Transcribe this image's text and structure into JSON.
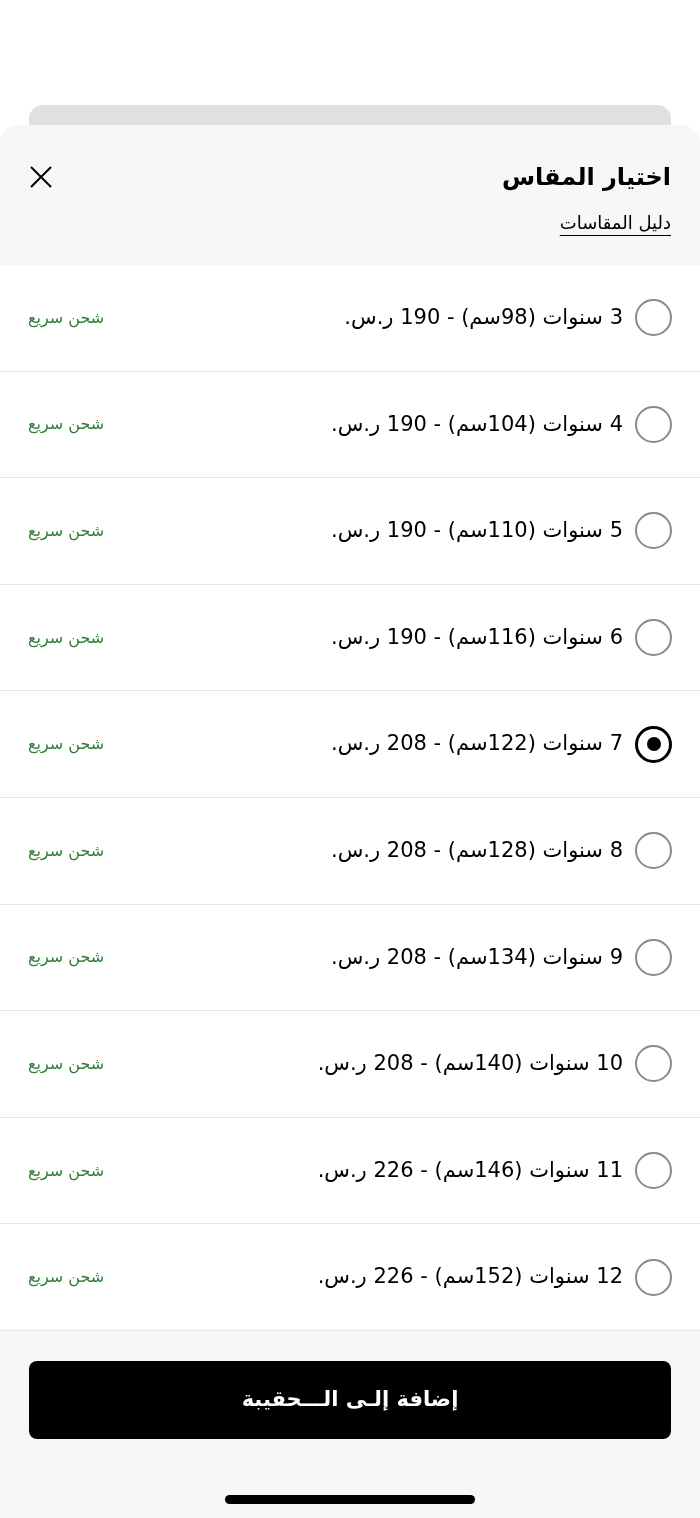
{
  "sheet": {
    "title": "اختيار المقاس",
    "size_guide_link": "دليل المقاسات"
  },
  "sizes": [
    {
      "label": "3 سنوات (98سم) - 190 ر.س.",
      "shipping": "شحن سريع",
      "selected": false
    },
    {
      "label": "4 سنوات (104سم) - 190 ر.س.",
      "shipping": "شحن سريع",
      "selected": false
    },
    {
      "label": "5 سنوات (110سم) - 190 ر.س.",
      "shipping": "شحن سريع",
      "selected": false
    },
    {
      "label": "6 سنوات (116سم) - 190 ر.س.",
      "shipping": "شحن سريع",
      "selected": false
    },
    {
      "label": "7 سنوات (122سم) - 208 ر.س.",
      "shipping": "شحن سريع",
      "selected": true
    },
    {
      "label": "8 سنوات (128سم) - 208 ر.س.",
      "shipping": "شحن سريع",
      "selected": false
    },
    {
      "label": "9 سنوات (134سم) - 208 ر.س.",
      "shipping": "شحن سريع",
      "selected": false
    },
    {
      "label": "10 سنوات (140سم) - 208 ر.س.",
      "shipping": "شحن سريع",
      "selected": false
    },
    {
      "label": "11 سنوات (146سم) - 226 ر.س.",
      "shipping": "شحن سريع",
      "selected": false
    },
    {
      "label": "12 سنوات (152سم) - 226 ر.س.",
      "shipping": "شحن سريع",
      "selected": false
    }
  ],
  "add_to_bag_button": "إضافة إلـى الـــحقيبة"
}
